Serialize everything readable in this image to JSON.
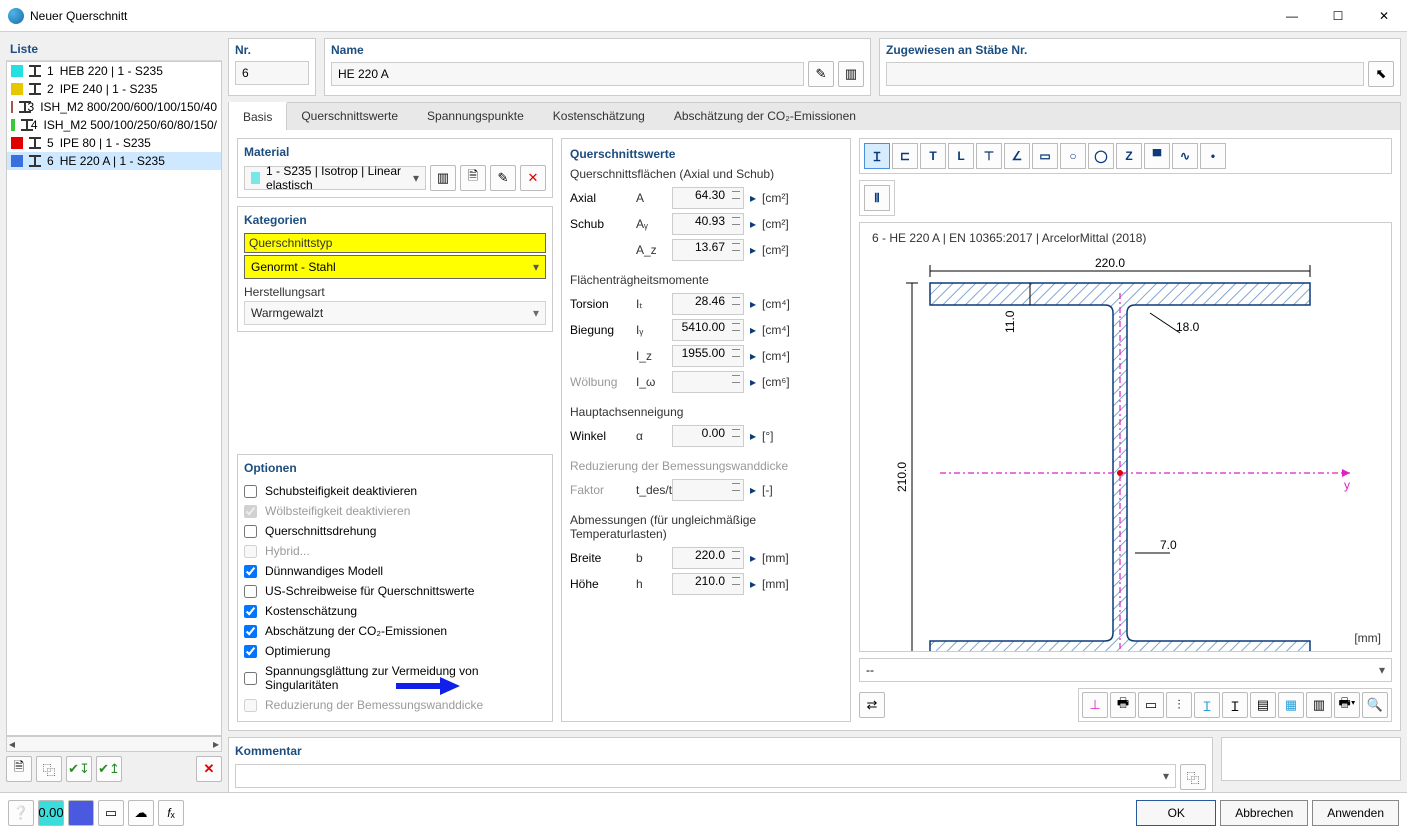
{
  "window": {
    "title": "Neuer Querschnitt"
  },
  "list": {
    "header": "Liste",
    "items": [
      {
        "n": "1",
        "label": "HEB 220 | 1 - S235",
        "color": "#26e0e0"
      },
      {
        "n": "2",
        "label": "IPE 240 | 1 - S235",
        "color": "#e6c800"
      },
      {
        "n": "3",
        "label": "ISH_M2 800/200/600/100/150/40",
        "color": "#9c5a4a"
      },
      {
        "n": "4",
        "label": "ISH_M2 500/100/250/60/80/150/",
        "color": "#37c837"
      },
      {
        "n": "5",
        "label": "IPE 80 | 1 - S235",
        "color": "#e00000"
      },
      {
        "n": "6",
        "label": "HE 220 A | 1 - S235",
        "color": "#3a6fe0"
      }
    ]
  },
  "nr": {
    "label": "Nr.",
    "value": "6"
  },
  "name": {
    "label": "Name",
    "value": "HE 220 A"
  },
  "assigned": {
    "label": "Zugewiesen an Stäbe Nr."
  },
  "tabs": [
    "Basis",
    "Querschnittswerte",
    "Spannungspunkte",
    "Kostenschätzung",
    "Abschätzung der CO₂-Emissionen"
  ],
  "material": {
    "header": "Material",
    "value": "1 - S235 | Isotrop | Linear elastisch"
  },
  "categories": {
    "header": "Kategorien",
    "type_label": "Querschnittstyp",
    "type_value": "Genormt - Stahl",
    "manu_label": "Herstellungsart",
    "manu_value": "Warmgewalzt"
  },
  "options": {
    "header": "Optionen",
    "items": [
      {
        "label": "Schubsteifigkeit deaktivieren",
        "checked": false,
        "disabled": false
      },
      {
        "label": "Wölbsteifigkeit deaktivieren",
        "checked": true,
        "disabled": true
      },
      {
        "label": "Querschnittsdrehung",
        "checked": false,
        "disabled": false
      },
      {
        "label": "Hybrid...",
        "checked": false,
        "disabled": true
      },
      {
        "label": "Dünnwandiges Modell",
        "checked": true,
        "disabled": false
      },
      {
        "label": "US-Schreibweise für Querschnittswerte",
        "checked": false,
        "disabled": false
      },
      {
        "label": "Kostenschätzung",
        "checked": true,
        "disabled": false
      },
      {
        "label": "Abschätzung der CO₂-Emissionen",
        "checked": true,
        "disabled": false
      },
      {
        "label": "Optimierung",
        "checked": true,
        "disabled": false
      },
      {
        "label": "Spannungsglättung zur Vermeidung von Singularitäten",
        "checked": false,
        "disabled": false
      },
      {
        "label": "Reduzierung der Bemessungswanddicke",
        "checked": false,
        "disabled": true
      }
    ]
  },
  "props": {
    "header": "Querschnittswerte",
    "groups": [
      {
        "title": "Querschnittsflächen (Axial und Schub)",
        "rows": [
          {
            "label": "Axial",
            "sym": "A",
            "value": "64.30",
            "unit": "[cm²]"
          },
          {
            "label": "Schub",
            "sym": "Aᵧ",
            "value": "40.93",
            "unit": "[cm²]"
          },
          {
            "label": "",
            "sym": "A_z",
            "value": "13.67",
            "unit": "[cm²]"
          }
        ]
      },
      {
        "title": "Flächenträgheitsmomente",
        "rows": [
          {
            "label": "Torsion",
            "sym": "Iₜ",
            "value": "28.46",
            "unit": "[cm⁴]"
          },
          {
            "label": "Biegung",
            "sym": "Iᵧ",
            "value": "5410.00",
            "unit": "[cm⁴]"
          },
          {
            "label": "",
            "sym": "I_z",
            "value": "1955.00",
            "unit": "[cm⁴]"
          },
          {
            "label": "Wölbung",
            "sym": "I_ω",
            "value": "",
            "unit": "[cm⁶]",
            "dim": true
          }
        ]
      },
      {
        "title": "Hauptachsenneigung",
        "rows": [
          {
            "label": "Winkel",
            "sym": "α",
            "value": "0.00",
            "unit": "[°]"
          }
        ]
      },
      {
        "title": "Reduzierung der Bemessungswanddicke",
        "dim": true,
        "rows": [
          {
            "label": "Faktor",
            "sym": "t_des/t",
            "value": "",
            "unit": "[-]",
            "dim": true
          }
        ]
      },
      {
        "title": "Abmessungen (für ungleichmäßige Temperaturlasten)",
        "rows": [
          {
            "label": "Breite",
            "sym": "b",
            "value": "220.0",
            "unit": "[mm]"
          },
          {
            "label": "Höhe",
            "sym": "h",
            "value": "210.0",
            "unit": "[mm]"
          }
        ]
      }
    ]
  },
  "preview": {
    "title": "6 - HE 220 A | EN 10365:2017 | ArcelorMittal (2018)",
    "dims": {
      "width": "220.0",
      "height": "210.0",
      "tf": "11.0",
      "tw": "7.0",
      "r": "18.0"
    },
    "unit": "[mm]",
    "footer_sel": "--"
  },
  "comment": {
    "header": "Kommentar"
  },
  "buttons": {
    "ok": "OK",
    "cancel": "Abbrechen",
    "apply": "Anwenden"
  }
}
